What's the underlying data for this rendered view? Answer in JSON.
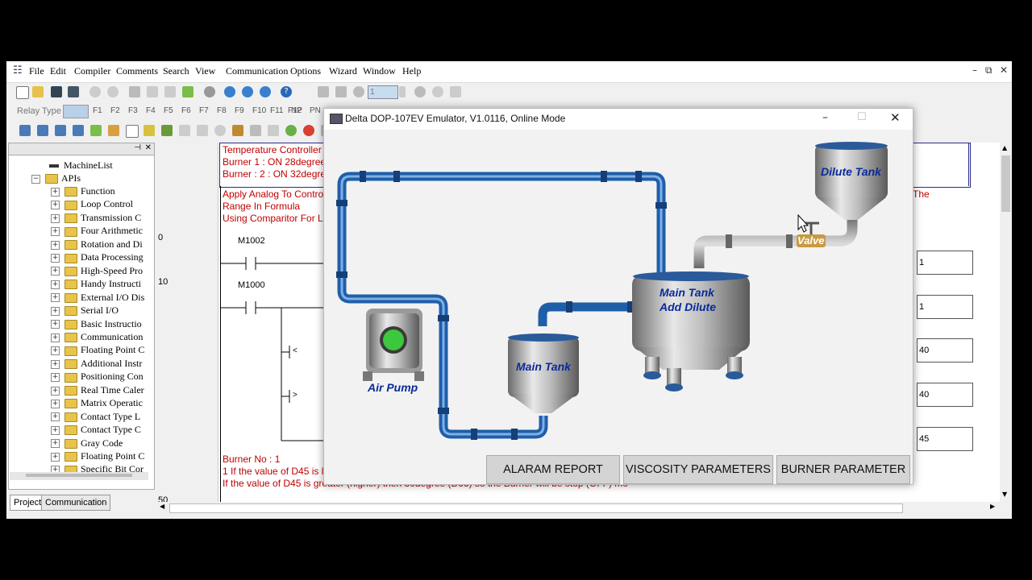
{
  "menubar": {
    "items": [
      "File",
      "Edit",
      "Compiler",
      "Comments",
      "Search",
      "View",
      "Communication",
      "Options",
      "Wizard",
      "Window",
      "Help"
    ],
    "window_controls": [
      "–",
      "⧉",
      "✕"
    ]
  },
  "toolbar": {
    "relay_type_label": "Relay Type",
    "station_value": "1",
    "fkeys": [
      "F1",
      "F2",
      "F3",
      "F4",
      "F5",
      "F6",
      "F7",
      "F8",
      "F9",
      "F10",
      "F11",
      "F12"
    ],
    "np_label": "NP",
    "pn_label": "PN"
  },
  "tree": {
    "root": "MachineList",
    "apis": "APIs",
    "items": [
      "Function",
      "Loop Control",
      "Transmission C",
      "Four Arithmetic",
      "Rotation and Di",
      "Data Processing",
      "High-Speed Pro",
      "Handy Instructi",
      "External I/O Dis",
      "Serial I/O",
      "Basic Instructio",
      "Communication",
      "Floating Point C",
      "Additional Instr",
      "Positioning Con",
      "Real Time Caler",
      "Matrix Operatic",
      "Contact Type L",
      "Contact Type C",
      "Gray Code",
      "Floating Point C",
      "Specific Bit Cor"
    ],
    "tabs": [
      "Project",
      "Communication"
    ]
  },
  "ladder": {
    "rung_numbers": [
      "0",
      "10",
      "50"
    ],
    "comment1": [
      "Temperature Controller",
      "Burner 1 : ON 28degree",
      "Burner : 2 : ON 32degree"
    ],
    "comment2": [
      "Apply Analog To Control",
      "Range In Formula",
      "Using Comparitor For L"
    ],
    "right_text": "The",
    "contacts": [
      "M1002",
      "M1000"
    ],
    "right_values": [
      "1",
      "1",
      "40",
      "40",
      "45"
    ],
    "compare_symbols": [
      "<",
      ">"
    ],
    "bottom_comment": [
      "Burner No : 1",
      "1 If the value of D45 is le",
      "If the value of D45 is greater (higher) then 30degree (D66) so the Burner will be stop (OFF) mo"
    ]
  },
  "emulator": {
    "title": "Delta DOP-107EV Emulator, V1.0116, Online Mode",
    "labels": {
      "dilute_tank": "Dilute Tank",
      "valve": "Valve",
      "main_tank_add_1": "Main Tank",
      "main_tank_add_2": "Add Dilute",
      "main_tank": "Main Tank",
      "air_pump": "Air Pump"
    },
    "buttons": [
      "ALARAM REPORT",
      "VISCOSITY PARAMETERS",
      "BURNER PARAMETER"
    ],
    "colors": {
      "pipe_blue": "#1f5ea8",
      "label_blue": "#0a2a9a",
      "pump_green": "#3cc83c"
    }
  }
}
